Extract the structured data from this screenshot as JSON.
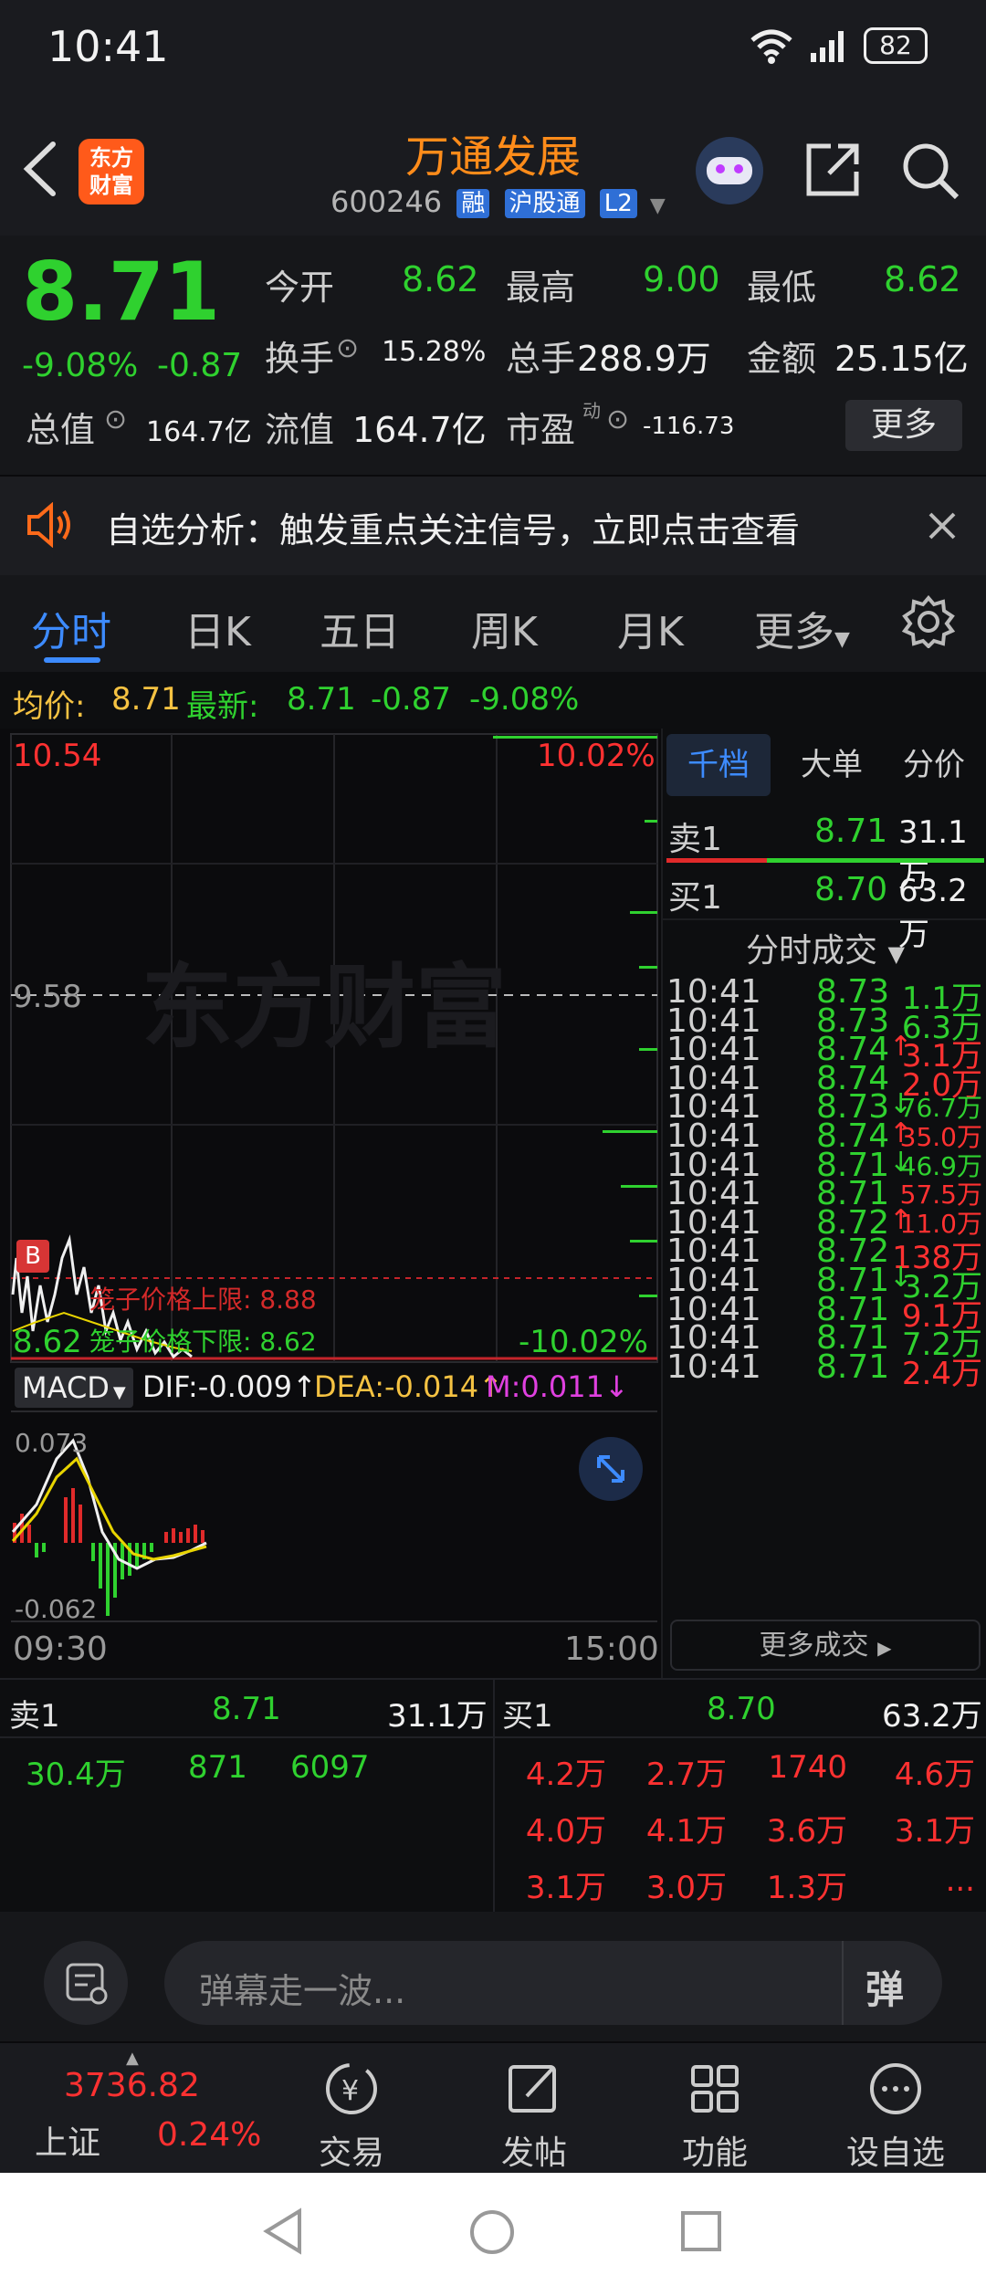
{
  "status_bar": {
    "time": "10:41",
    "battery": "82"
  },
  "header": {
    "logo_text_top": "东方",
    "logo_text_bottom": "财富",
    "stock_name": "万通发展",
    "stock_code": "600246",
    "tags": [
      "融",
      "沪股通",
      "L2"
    ]
  },
  "quote": {
    "price": "8.71",
    "change_pct": "-9.08%",
    "change": "-0.87",
    "open_label": "今开",
    "open": "8.62",
    "high_label": "最高",
    "high": "9.00",
    "low_label": "最低",
    "low": "8.62",
    "turnover_label": "换手",
    "turnover": "15.28%",
    "volume_label": "总手",
    "volume": "288.9万",
    "amount_label": "金额",
    "amount": "25.15亿",
    "total_value_label": "总值",
    "total_value": "164.7亿",
    "float_value_label": "流值",
    "float_value": "164.7亿",
    "pe_label": "市盈",
    "pe_superscript": "动",
    "pe": "-116.73",
    "more_button": "更多"
  },
  "notice": {
    "text": "自选分析：触发重点关注信号，立即点击查看"
  },
  "tabs": {
    "items": [
      "分时",
      "日K",
      "五日",
      "周K",
      "月K",
      "更多"
    ],
    "active": "分时"
  },
  "info_line": {
    "avg_label": "均价:",
    "avg": "8.71",
    "latest_label": "最新:",
    "latest": "8.71",
    "change": "-0.87",
    "change_pct": "-9.08%"
  },
  "chart": {
    "y_top": "10.54",
    "y_top_pct": "10.02%",
    "y_mid": "9.58",
    "y_bottom": "8.62",
    "y_bottom_pct": "-10.02%",
    "watermark": "东方财富",
    "upper_limit_text": "笼子价格上限:  8.88",
    "lower_limit_text": "笼子价格下限:  8.62",
    "b_marker": "B",
    "macd_label": "MACD",
    "dif": "DIF:-0.009",
    "dea": "DEA:-0.014",
    "m": "M:0.011",
    "macd_top": "0.073",
    "macd_bottom": "-0.062",
    "time_start": "09:30",
    "time_end": "15:00"
  },
  "side_panel": {
    "tabs": [
      "千档",
      "大单",
      "分价"
    ],
    "sell1_label": "卖1",
    "sell1_price": "8.71",
    "sell1_vol": "31.1万",
    "buy1_label": "买1",
    "buy1_price": "8.70",
    "buy1_vol": "63.2万",
    "trades_header": "分时成交",
    "trades": [
      {
        "t": "10:41",
        "p": "8.73",
        "dir": "",
        "v": "1.1万",
        "vc": "green"
      },
      {
        "t": "10:41",
        "p": "8.73",
        "dir": "",
        "v": "6.3万",
        "vc": "green"
      },
      {
        "t": "10:41",
        "p": "8.74",
        "dir": "↑",
        "v": "3.1万",
        "vc": "red"
      },
      {
        "t": "10:41",
        "p": "8.74",
        "dir": "",
        "v": "2.0万",
        "vc": "red"
      },
      {
        "t": "10:41",
        "p": "8.73",
        "dir": "↓",
        "v": "76.7万",
        "vc": "green"
      },
      {
        "t": "10:41",
        "p": "8.74",
        "dir": "↑",
        "v": "35.0万",
        "vc": "red"
      },
      {
        "t": "10:41",
        "p": "8.71",
        "dir": "↓",
        "v": "46.9万",
        "vc": "green"
      },
      {
        "t": "10:41",
        "p": "8.71",
        "dir": "",
        "v": "57.5万",
        "vc": "red"
      },
      {
        "t": "10:41",
        "p": "8.72",
        "dir": "↑",
        "v": "11.0万",
        "vc": "red"
      },
      {
        "t": "10:41",
        "p": "8.72",
        "dir": "",
        "v": "138万",
        "vc": "red"
      },
      {
        "t": "10:41",
        "p": "8.71",
        "dir": "↓",
        "v": "3.2万",
        "vc": "green"
      },
      {
        "t": "10:41",
        "p": "8.71",
        "dir": "",
        "v": "9.1万",
        "vc": "red"
      },
      {
        "t": "10:41",
        "p": "8.71",
        "dir": "",
        "v": "7.2万",
        "vc": "green"
      },
      {
        "t": "10:41",
        "p": "8.71",
        "dir": "",
        "v": "2.4万",
        "vc": "red"
      }
    ],
    "more_trades": "更多成交"
  },
  "book": {
    "sell_label": "卖1",
    "sell_price": "8.71",
    "sell_vol": "31.1万",
    "buy_label": "买1",
    "buy_price": "8.70",
    "buy_vol": "63.2万",
    "sell_queue": [
      "30.4万",
      "871",
      "6097"
    ],
    "buy_queue": [
      [
        "4.2万",
        "2.7万",
        "1740",
        "4.6万"
      ],
      [
        "4.0万",
        "4.1万",
        "3.6万",
        "3.1万"
      ],
      [
        "3.1万",
        "3.0万",
        "1.3万",
        "..."
      ]
    ]
  },
  "danmu": {
    "placeholder": "弹幕走一波...",
    "send": "弹"
  },
  "bottom_nav": {
    "index_value": "3736.82",
    "index_name": "上证",
    "index_pct": "0.24%",
    "items": [
      "交易",
      "发帖",
      "功能",
      "设自选"
    ]
  }
}
